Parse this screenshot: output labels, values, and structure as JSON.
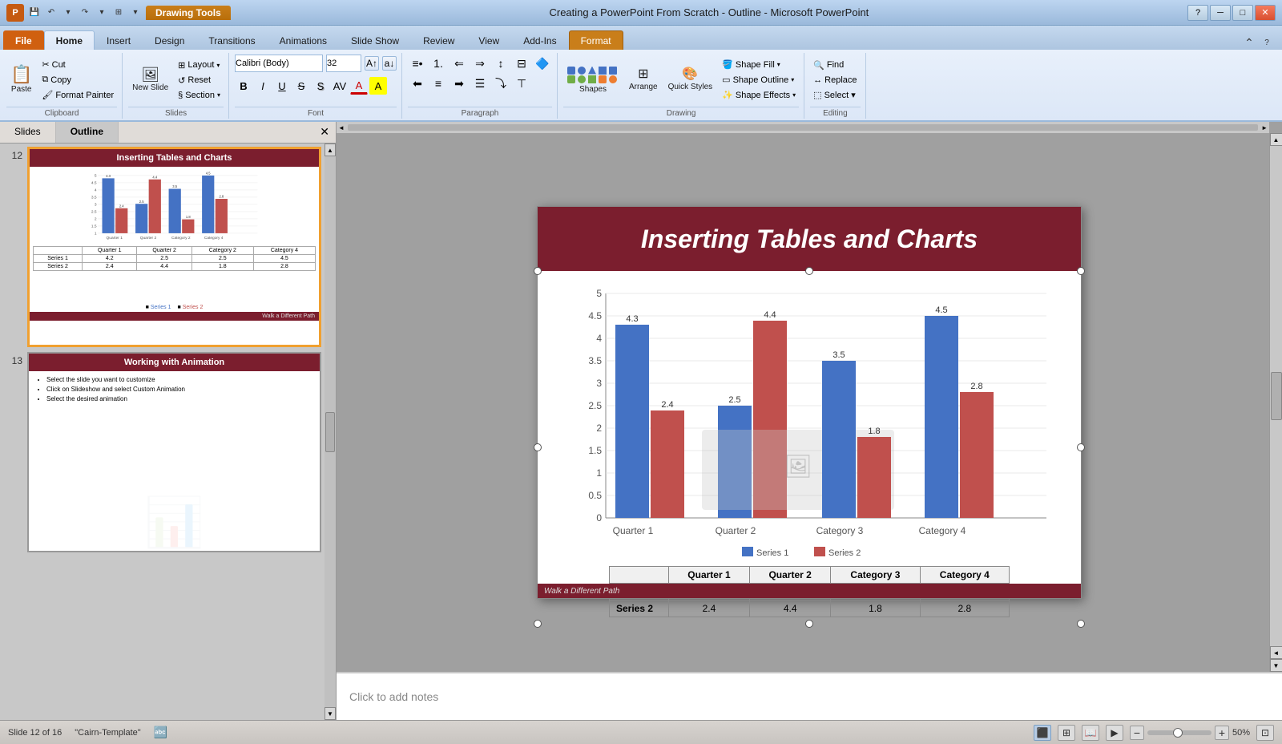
{
  "titlebar": {
    "title": "Creating a PowerPoint From Scratch - Outline - Microsoft PowerPoint",
    "drawing_tools": "Drawing Tools",
    "minimize": "─",
    "maximize": "□",
    "close": "✕",
    "logo": "P"
  },
  "ribbon": {
    "tabs": [
      "File",
      "Home",
      "Insert",
      "Design",
      "Transitions",
      "Animations",
      "Slide Show",
      "Review",
      "View",
      "Add-Ins",
      "Format"
    ],
    "active_tab": "Home",
    "format_tab": "Format",
    "groups": {
      "clipboard": {
        "label": "Clipboard",
        "paste": "Paste",
        "cut": "Cut",
        "copy": "Copy",
        "format_painter": "Format Painter"
      },
      "slides": {
        "label": "Slides",
        "new_slide": "New Slide",
        "layout": "Layout",
        "reset": "Reset",
        "section": "Section"
      },
      "font": {
        "label": "Font",
        "family": "Calibri (Body)",
        "size": "32",
        "bold": "B",
        "italic": "I",
        "underline": "U",
        "strikethrough": "S",
        "shadow": "S",
        "char_spacing": "AV",
        "font_color": "A",
        "increase": "A",
        "decrease": "a"
      },
      "paragraph": {
        "label": "Paragraph",
        "bullets": "bullets",
        "numbering": "numbering",
        "decrease_indent": "decrease",
        "increase_indent": "increase",
        "align_left": "≡",
        "align_center": "≡",
        "align_right": "≡",
        "justify": "≡"
      },
      "drawing": {
        "label": "Drawing",
        "shapes": "Shapes",
        "arrange": "Arrange",
        "quick_styles": "Quick Styles",
        "shape_fill": "Shape Fill",
        "shape_outline": "Shape Outline",
        "shape_effects": "Shape Effects"
      },
      "editing": {
        "label": "Editing",
        "find": "Find",
        "replace": "Replace",
        "select": "Select ▾"
      }
    }
  },
  "panel": {
    "tabs": [
      "Slides",
      "Outline"
    ],
    "active_tab": "Outline"
  },
  "slides": [
    {
      "num": 12,
      "title": "Inserting Tables and Charts",
      "selected": true
    },
    {
      "num": 13,
      "title": "Working with Animation",
      "selected": false
    }
  ],
  "slide13": {
    "title": "Working with Animation",
    "bullets": [
      "Select the slide you want to customize",
      "Click on Slideshow and select Custom Animation",
      "Select the desired animation"
    ]
  },
  "main_slide": {
    "title": "Inserting Tables and Charts",
    "footer": "Walk a Different Path"
  },
  "chart": {
    "categories": [
      "Quarter 1",
      "Quarter 2",
      "Category 3",
      "Category 4"
    ],
    "series": [
      {
        "name": "Series 1",
        "color": "#4472c4",
        "values": [
          4.3,
          2.5,
          3.5,
          4.5
        ]
      },
      {
        "name": "Series 2",
        "color": "#c0504d",
        "values": [
          2.4,
          4.4,
          1.8,
          2.8
        ]
      }
    ],
    "yAxis": [
      0,
      0.5,
      1,
      1.5,
      2,
      2.5,
      3,
      3.5,
      4,
      4.5,
      5
    ],
    "labels": {
      "s1": [
        4.3,
        2.5,
        3.5,
        4.5
      ],
      "s2": [
        2.4,
        4.4,
        1.8,
        2.8
      ]
    }
  },
  "notes": {
    "placeholder": "Click to add notes"
  },
  "statusbar": {
    "slide_info": "Slide 12 of 16",
    "template": "\"Cairn-Template\"",
    "zoom": "50%"
  }
}
